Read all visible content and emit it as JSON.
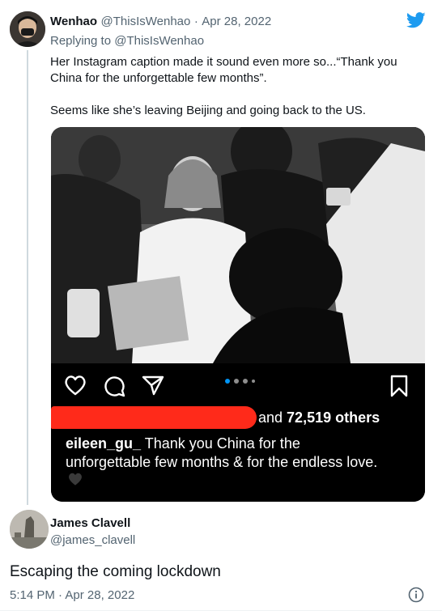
{
  "tweet": {
    "author_name": "Wenhao",
    "author_handle": "@ThisIsWenhao",
    "separator": "·",
    "date": "Apr 28, 2022",
    "replying_prefix": "Replying to ",
    "replying_handle": "@ThisIsWenhao",
    "text_line1": "Her Instagram caption made it sound even more so...“Thank you",
    "text_line2": "China for the unforgettable few months”.",
    "text_line3": "Seems like she’s leaving Beijing and going back to the US."
  },
  "instagram": {
    "likes_prefix": "and ",
    "likes_count": "72,519 others",
    "caption_user": "eileen_gu_",
    "caption_line1": " Thank you China for the",
    "caption_line2": "unforgettable few months & for the endless love.",
    "caption_emoji": "🖤",
    "carousel_total": 4,
    "carousel_active": 1
  },
  "reply": {
    "author_name": "James Clavell",
    "author_handle": "@james_clavell",
    "text": "Escaping the coming lockdown",
    "time": "5:14 PM",
    "separator": "·",
    "date": "Apr 28, 2022"
  },
  "colors": {
    "twitter_blue": "#1d9bf0",
    "muted": "#536471",
    "redaction": "#ff2a1a",
    "ig_blue_dot": "#0095f6"
  },
  "icons": [
    "twitter-bird-icon",
    "heart-icon",
    "comment-icon",
    "share-icon",
    "bookmark-icon",
    "info-icon"
  ]
}
